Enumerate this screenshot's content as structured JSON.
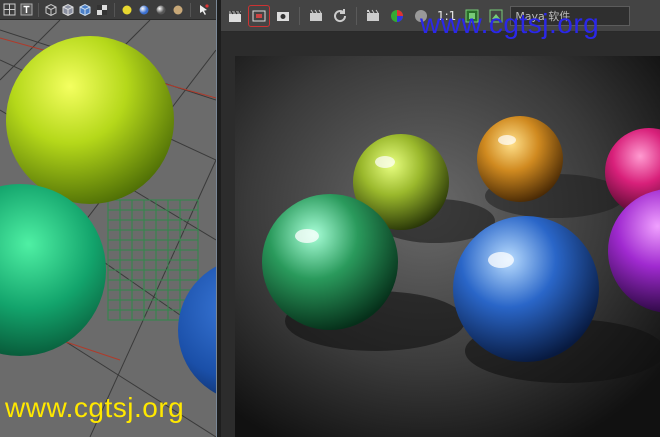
{
  "viewport": {
    "toolbar_icons": [
      "grid-icon",
      "text-tool-icon",
      "wireframe-cube-icon",
      "shaded-cube-icon",
      "textured-cube-icon",
      "xray-icon",
      "light-icon",
      "lit-sphere-icon",
      "shadow-icon",
      "isolate-icon",
      "selection-icon"
    ],
    "spheres": [
      {
        "name": "yellow-green-sphere",
        "color": "#b5d81a"
      },
      {
        "name": "teal-green-sphere",
        "color": "#13a46c"
      },
      {
        "name": "blue-sphere",
        "color": "#1a4fa8"
      }
    ]
  },
  "render_view": {
    "toolbar": {
      "icons": [
        "clapper-icon",
        "render-region-icon",
        "snapshot-icon",
        "ipr-icon",
        "refresh-icon",
        "render-settings-icon",
        "rgb-channel-icon",
        "alpha-channel-icon"
      ],
      "resolution_label": "1:1",
      "camera_select_value": "Maya 软件"
    },
    "spheres": [
      {
        "name": "yellow-metallic-sphere",
        "color": "#9ab82c"
      },
      {
        "name": "orange-metallic-sphere",
        "color": "#d08a20"
      },
      {
        "name": "pink-metallic-sphere",
        "color": "#d8207a"
      },
      {
        "name": "green-metallic-sphere",
        "color": "#2a9a5c"
      },
      {
        "name": "blue-metallic-sphere",
        "color": "#2a66c8"
      },
      {
        "name": "purple-metallic-sphere",
        "color": "#a02ad0"
      }
    ]
  },
  "watermarks": {
    "top": "www.cgtsj.org",
    "bottom": "www.cgtsj.org"
  }
}
